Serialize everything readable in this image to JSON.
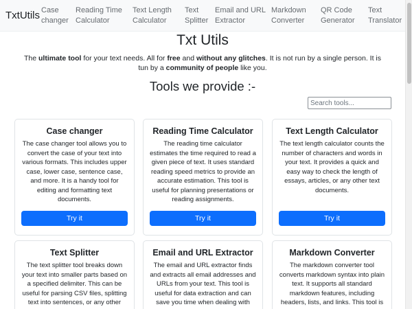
{
  "navbar": {
    "brand": "TxtUtils",
    "links": [
      {
        "label": "Case changer"
      },
      {
        "label": "Reading Time Calculator"
      },
      {
        "label": "Text Length Calculator"
      },
      {
        "label": "Text Splitter"
      },
      {
        "label": "Email and URL Extractor"
      },
      {
        "label": "Markdown Converter"
      },
      {
        "label": "QR Code Generator"
      },
      {
        "label": "Text Translator"
      }
    ]
  },
  "hero": {
    "title": "Txt Utils",
    "intro": {
      "p1": "The ",
      "b1": "ultimate tool",
      "p2": " for your text needs. All for ",
      "b2": "free",
      "p3": " and ",
      "b3": "without any glitches",
      "p4": ". It is not run by a single person. It is tun by a ",
      "b4": "community of people",
      "p5": " like you."
    }
  },
  "tools_section": {
    "title": "Tools we provide :-",
    "search_placeholder": "Search tools..."
  },
  "cards": [
    {
      "title": "Case changer",
      "text": "The case changer tool allows you to convert the case of your text into various formats. This includes upper case, lower case, sentence case, and more. It is a handy tool for editing and formatting text documents.",
      "button": "Try it"
    },
    {
      "title": "Reading Time Calculator",
      "text": "The reading time calculator estimates the time required to read a given piece of text. It uses standard reading speed metrics to provide an accurate estimation. This tool is useful for planning presentations or reading assignments.",
      "button": "Try it"
    },
    {
      "title": "Text Length Calculator",
      "text": "The text length calculator counts the number of characters and words in your text. It provides a quick and easy way to check the length of essays, articles, or any other text documents.",
      "button": "Try it"
    },
    {
      "title": "Text Splitter",
      "text": "The text splitter tool breaks down your text into smaller parts based on a specified delimiter. This can be useful for parsing CSV files, splitting text into sentences, or any other"
    },
    {
      "title": "Email and URL Extractor",
      "text": "The email and URL extractor finds and extracts all email addresses and URLs from your text. This tool is useful for data extraction and can save you time when dealing with"
    },
    {
      "title": "Markdown Converter",
      "text": "The markdown converter tool converts markdown syntax into plain text. It supports all standard markdown features, including headers, lists, and links. This tool is"
    }
  ],
  "colors": {
    "primary_button": "#0d6efd",
    "navbar_bg": "#f8f9fa"
  }
}
